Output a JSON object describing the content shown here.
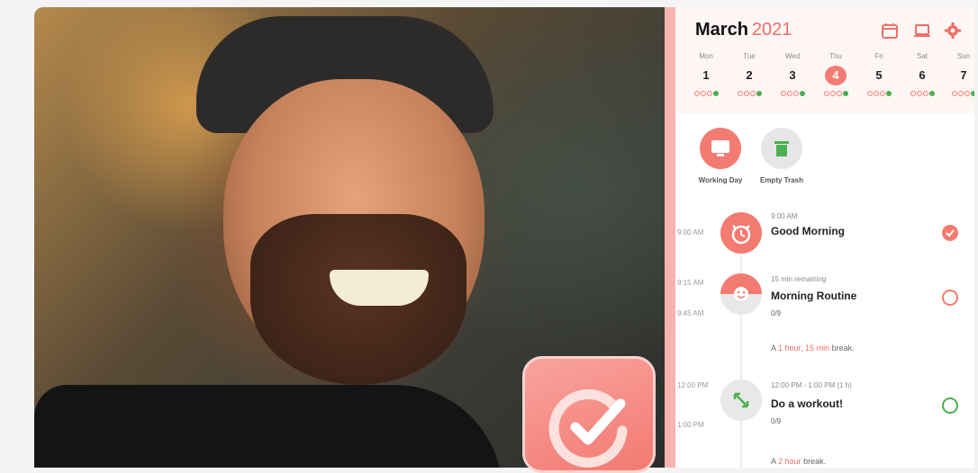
{
  "calendar": {
    "month": "March",
    "year": "2021",
    "days": [
      {
        "name": "Mon",
        "num": "1"
      },
      {
        "name": "Tue",
        "num": "2"
      },
      {
        "name": "Wed",
        "num": "3"
      },
      {
        "name": "Thu",
        "num": "4"
      },
      {
        "name": "Fri",
        "num": "5"
      },
      {
        "name": "Sat",
        "num": "6"
      },
      {
        "name": "Sun",
        "num": "7"
      }
    ],
    "active_day": "4"
  },
  "header_icons": [
    "calendar-icon",
    "laptop-icon",
    "gear-icon"
  ],
  "quick_actions": [
    {
      "label": "Working Day",
      "icon": "monitor-icon"
    },
    {
      "label": "Empty Trash",
      "icon": "trash-icon"
    }
  ],
  "timeline": {
    "t1": {
      "time": "9:00 AM",
      "sub": "9:00 AM",
      "title": "Good Morning",
      "meta": "",
      "done": true
    },
    "t2": {
      "time_start": "9:15 AM",
      "time_end": "9:45 AM",
      "sub": "15 min remaining",
      "title": "Morning Routine",
      "meta": "0/9",
      "done": false
    },
    "break1": {
      "prefix": "A",
      "duration": "1 hour, 15 min",
      "suffix": "break."
    },
    "t3": {
      "time_start": "12:00 PM",
      "time_end": "1:00 PM",
      "sub": "12:00 PM - 1:00 PM (1 h)",
      "title": "Do a workout!",
      "meta": "0/9",
      "done": false
    },
    "break2": {
      "prefix": "A",
      "duration": "2 hour",
      "suffix": "break."
    }
  },
  "colors": {
    "accent": "#f47b72",
    "green": "#4bb050"
  }
}
